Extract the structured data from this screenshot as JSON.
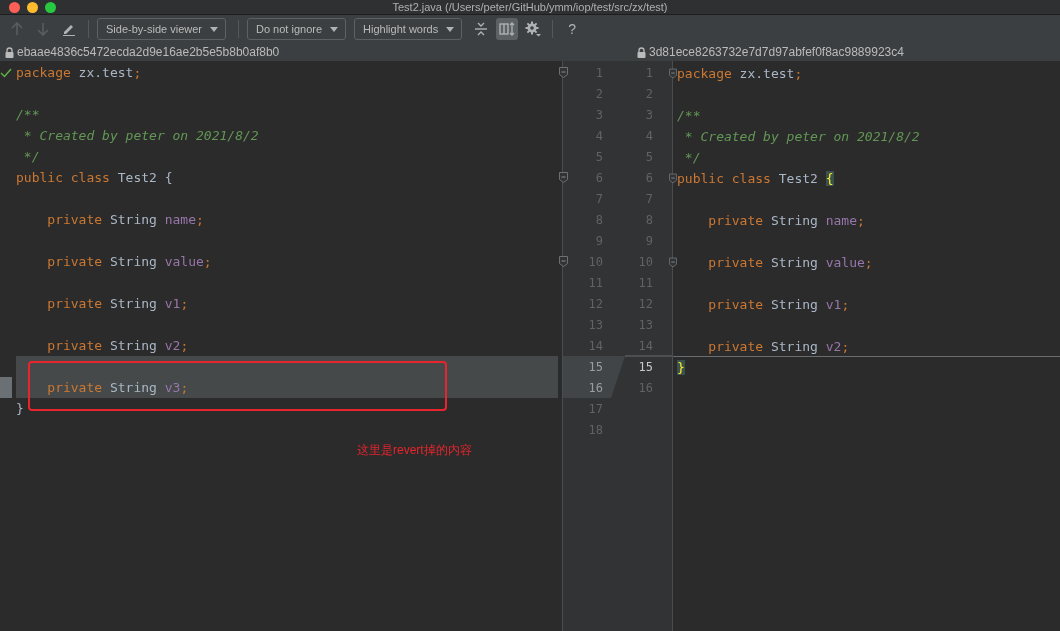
{
  "window": {
    "title": "Test2.java (/Users/peter/GitHub/ymm/iop/test/src/zx/test)"
  },
  "toolbar": [
    {
      "kind": "prev",
      "disabled": true
    },
    {
      "kind": "next",
      "disabled": true
    },
    {
      "kind": "edit",
      "disabled": false
    },
    {
      "kind": "separator"
    },
    {
      "kind": "dropdown",
      "label": "Side-by-side viewer"
    },
    {
      "kind": "separator"
    },
    {
      "kind": "dropdown",
      "label": "Do not ignore"
    },
    {
      "kind": "dropdown",
      "label": "Highlight words"
    },
    {
      "kind": "collapse",
      "selected": false
    },
    {
      "kind": "sync",
      "selected": true
    },
    {
      "kind": "settings"
    },
    {
      "kind": "separator"
    },
    {
      "kind": "help",
      "label": "?"
    }
  ],
  "left": {
    "hash": "ebaae4836c5472ecda2d9e16ae2b5e5b8b0af8b0",
    "lines": [
      {
        "number": "1",
        "fold": true,
        "changed": false,
        "current": false,
        "tokens": [
          {
            "kind": "kw",
            "text": "package"
          },
          {
            "kind": "plain",
            "text": " zx.test"
          },
          {
            "kind": "kw",
            "text": ";"
          }
        ]
      },
      {
        "number": "2",
        "fold": false,
        "changed": false,
        "current": false
      },
      {
        "number": "3",
        "fold": false,
        "changed": false,
        "current": false,
        "tokens": [
          {
            "kind": "comment",
            "text": "/**"
          }
        ]
      },
      {
        "number": "4",
        "fold": false,
        "changed": false,
        "current": false,
        "tokens": [
          {
            "kind": "comment",
            "text": " * Created by peter on 2021/8/2"
          }
        ]
      },
      {
        "number": "5",
        "fold": false,
        "changed": false,
        "current": false,
        "tokens": [
          {
            "kind": "comment",
            "text": " */"
          }
        ]
      },
      {
        "number": "6",
        "fold": true,
        "changed": false,
        "current": false,
        "tokens": [
          {
            "kind": "kw",
            "text": "public class"
          },
          {
            "kind": "plain",
            "text": " Test2 {"
          }
        ]
      },
      {
        "number": "7",
        "fold": false,
        "changed": false,
        "current": false
      },
      {
        "number": "8",
        "fold": false,
        "changed": false,
        "current": false,
        "tokens": [
          {
            "kind": "kw",
            "text": "    private"
          },
          {
            "kind": "plain",
            "text": " String "
          },
          {
            "kind": "field",
            "text": "name"
          },
          {
            "kind": "kw",
            "text": ";"
          }
        ]
      },
      {
        "number": "9",
        "fold": false,
        "changed": false,
        "current": false
      },
      {
        "number": "10",
        "fold": true,
        "changed": false,
        "current": false,
        "tokens": [
          {
            "kind": "kw",
            "text": "    private"
          },
          {
            "kind": "plain",
            "text": " String "
          },
          {
            "kind": "field",
            "text": "value"
          },
          {
            "kind": "kw",
            "text": ";"
          }
        ]
      },
      {
        "number": "11",
        "fold": false,
        "changed": false,
        "current": false
      },
      {
        "number": "12",
        "fold": false,
        "changed": false,
        "current": false,
        "tokens": [
          {
            "kind": "kw",
            "text": "    private"
          },
          {
            "kind": "plain",
            "text": " String "
          },
          {
            "kind": "field",
            "text": "v1"
          },
          {
            "kind": "kw",
            "text": ";"
          }
        ]
      },
      {
        "number": "13",
        "fold": false,
        "changed": false,
        "current": false
      },
      {
        "number": "14",
        "fold": false,
        "changed": false,
        "current": false,
        "tokens": [
          {
            "kind": "kw",
            "text": "    private"
          },
          {
            "kind": "plain",
            "text": " String "
          },
          {
            "kind": "field",
            "text": "v2"
          },
          {
            "kind": "kw",
            "text": ";"
          }
        ]
      },
      {
        "number": "15",
        "fold": false,
        "changed": true,
        "current": true
      },
      {
        "number": "16",
        "fold": false,
        "changed": true,
        "current": false,
        "tokens": [
          {
            "kind": "kw",
            "text": "    private"
          },
          {
            "kind": "plain",
            "text": " String "
          },
          {
            "kind": "field",
            "text": "v3"
          },
          {
            "kind": "kw",
            "text": ";"
          }
        ]
      },
      {
        "number": "17",
        "fold": false,
        "changed": false,
        "current": false,
        "tokens": [
          {
            "kind": "plain",
            "text": "}"
          }
        ]
      },
      {
        "number": "18",
        "fold": false,
        "changed": false,
        "current": false
      }
    ]
  },
  "right": {
    "hash": "3d81ece8263732e7d7d97abfef0f8ac9889923c4",
    "lines": [
      {
        "number": "1",
        "fold": true,
        "gap_above": false,
        "current": false,
        "tokens": [
          {
            "kind": "kw",
            "text": "package"
          },
          {
            "kind": "plain",
            "text": " zx.test"
          },
          {
            "kind": "kw",
            "text": ";"
          }
        ]
      },
      {
        "number": "2",
        "fold": false,
        "gap_above": false,
        "current": false
      },
      {
        "number": "3",
        "fold": false,
        "gap_above": false,
        "current": false,
        "tokens": [
          {
            "kind": "comment",
            "text": "/**"
          }
        ]
      },
      {
        "number": "4",
        "fold": false,
        "gap_above": false,
        "current": false,
        "tokens": [
          {
            "kind": "comment",
            "text": " * Created by peter on 2021/8/2"
          }
        ]
      },
      {
        "number": "5",
        "fold": false,
        "gap_above": false,
        "current": false,
        "tokens": [
          {
            "kind": "comment",
            "text": " */"
          }
        ]
      },
      {
        "number": "6",
        "fold": true,
        "gap_above": false,
        "current": false,
        "tokens": [
          {
            "kind": "kw",
            "text": "public class"
          },
          {
            "kind": "plain",
            "text": " Test2 "
          },
          {
            "kind": "match",
            "text": "{"
          }
        ]
      },
      {
        "number": "7",
        "fold": false,
        "gap_above": false,
        "current": false
      },
      {
        "number": "8",
        "fold": false,
        "gap_above": false,
        "current": false,
        "tokens": [
          {
            "kind": "kw",
            "text": "    private"
          },
          {
            "kind": "plain",
            "text": " String "
          },
          {
            "kind": "field",
            "text": "name"
          },
          {
            "kind": "kw",
            "text": ";"
          }
        ]
      },
      {
        "number": "9",
        "fold": false,
        "gap_above": false,
        "current": false
      },
      {
        "number": "10",
        "fold": true,
        "gap_above": false,
        "current": false,
        "tokens": [
          {
            "kind": "kw",
            "text": "    private"
          },
          {
            "kind": "plain",
            "text": " String "
          },
          {
            "kind": "field",
            "text": "value"
          },
          {
            "kind": "kw",
            "text": ";"
          }
        ]
      },
      {
        "number": "11",
        "fold": false,
        "gap_above": false,
        "current": false
      },
      {
        "number": "12",
        "fold": false,
        "gap_above": false,
        "current": false,
        "tokens": [
          {
            "kind": "kw",
            "text": "    private"
          },
          {
            "kind": "plain",
            "text": " String "
          },
          {
            "kind": "field",
            "text": "v1"
          },
          {
            "kind": "kw",
            "text": ";"
          }
        ]
      },
      {
        "number": "13",
        "fold": false,
        "gap_above": false,
        "current": false
      },
      {
        "number": "14",
        "fold": false,
        "gap_above": false,
        "current": false,
        "tokens": [
          {
            "kind": "kw",
            "text": "    private"
          },
          {
            "kind": "plain",
            "text": " String "
          },
          {
            "kind": "field",
            "text": "v2"
          },
          {
            "kind": "kw",
            "text": ";"
          }
        ]
      },
      {
        "number": "15",
        "fold": false,
        "gap_above": true,
        "current": true,
        "tokens": [
          {
            "kind": "match",
            "text": "}"
          }
        ]
      },
      {
        "number": "16",
        "fold": false,
        "gap_above": false,
        "current": false
      }
    ]
  },
  "annotation": {
    "text": "这里是revert掉的内容"
  }
}
